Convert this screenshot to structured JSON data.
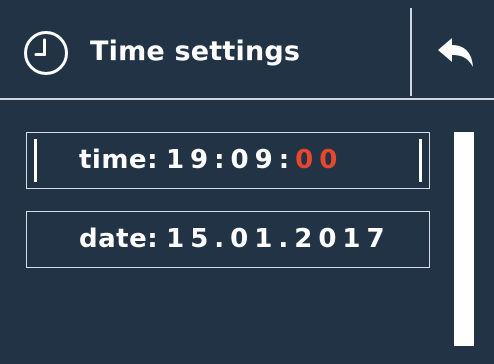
{
  "header": {
    "title": "Time settings",
    "icon": "clock-icon",
    "back_icon": "back-arrow-icon"
  },
  "time_field": {
    "label": "time:",
    "value_normal": "19:09:",
    "value_highlight": "00",
    "highlight_color": "#e8462d"
  },
  "date_field": {
    "label": "date:",
    "value": "15.01.2017"
  },
  "colors": {
    "background": "#223346",
    "foreground": "#ffffff",
    "highlight": "#e8462d"
  }
}
